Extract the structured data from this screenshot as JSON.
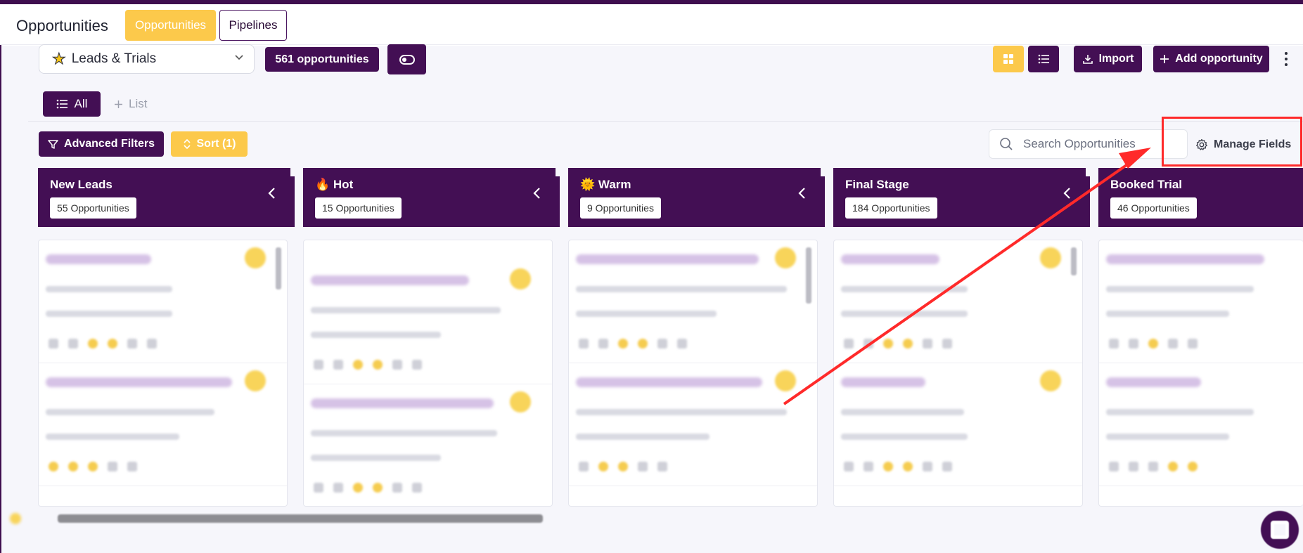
{
  "header": {
    "title": "Opportunities",
    "tabs": [
      {
        "label": "Opportunities",
        "active": true
      },
      {
        "label": "Pipelines",
        "active": false
      }
    ]
  },
  "toolbar": {
    "pipeline_select": {
      "icon": "star-icon",
      "value": "Leads & Trials"
    },
    "count_label": "561 opportunities",
    "import_label": "Import",
    "add_label": "Add opportunity"
  },
  "views": {
    "all_label": "All",
    "add_list_label": "List"
  },
  "filters": {
    "advanced_label": "Advanced Filters",
    "sort_label": "Sort (1)",
    "search_placeholder": "Search Opportunities",
    "manage_fields_label": "Manage Fields"
  },
  "columns": [
    {
      "title": "New Leads",
      "count": "55 Opportunities",
      "emoji": ""
    },
    {
      "title": "Hot",
      "count": "15 Opportunities",
      "emoji": "🔥"
    },
    {
      "title": "Warm",
      "count": "9 Opportunities",
      "emoji": "🌞"
    },
    {
      "title": "Final Stage",
      "count": "184 Opportunities",
      "emoji": ""
    },
    {
      "title": "Booked Trial",
      "count": "46 Opportunities",
      "emoji": ""
    }
  ],
  "colors": {
    "brand_purple": "#430f54",
    "brand_yellow": "#fcc94b",
    "highlight_red": "#ff2a2a"
  }
}
